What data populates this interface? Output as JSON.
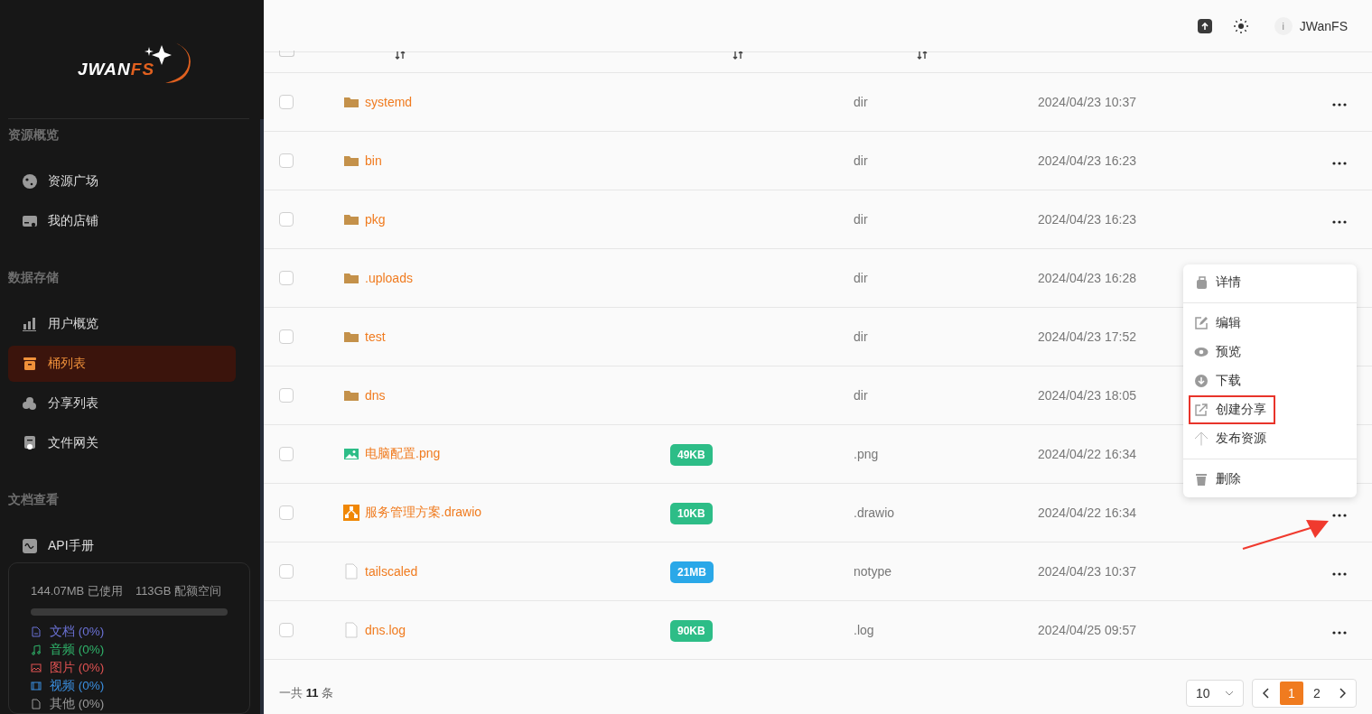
{
  "logo": {
    "main": "JWAN",
    "accent": "FS"
  },
  "sidebar": {
    "sections": [
      {
        "title": "资源概览",
        "items": [
          {
            "label": "资源广场",
            "kind": "globe",
            "selected": false
          },
          {
            "label": "我的店铺",
            "kind": "store",
            "selected": false
          }
        ]
      },
      {
        "title": "数据存储",
        "items": [
          {
            "label": "用户概览",
            "kind": "chart",
            "selected": false
          },
          {
            "label": "桶列表",
            "kind": "bucket",
            "selected": true
          },
          {
            "label": "分享列表",
            "kind": "cloud",
            "selected": false
          },
          {
            "label": "文件网关",
            "kind": "gateway",
            "selected": false
          }
        ]
      },
      {
        "title": "文档查看",
        "items": [
          {
            "label": "API手册",
            "kind": "api",
            "selected": false
          }
        ]
      }
    ],
    "storage": {
      "used": "144.07MB 已使用",
      "quota": "113GB 配额空间",
      "categories": [
        {
          "label": "文档 (0%)",
          "kind": "doc",
          "color": "#6b72d6"
        },
        {
          "label": "音频 (0%)",
          "kind": "audio",
          "color": "#2fb36a"
        },
        {
          "label": "图片 (0%)",
          "kind": "image",
          "color": "#e05252"
        },
        {
          "label": "视频 (0%)",
          "kind": "video",
          "color": "#3b8fe0"
        },
        {
          "label": "其他 (0%)",
          "kind": "other",
          "color": "#9a9a9a"
        }
      ]
    }
  },
  "topbar": {
    "avatar": "i",
    "user": "JWanFS"
  },
  "table": {
    "select_all_checked": false,
    "rows": [
      {
        "name": "systemd",
        "kind": "folder",
        "type": "dir",
        "date": "2024/04/23 10:37",
        "checked": false
      },
      {
        "name": "bin",
        "kind": "folder",
        "type": "dir",
        "date": "2024/04/23 16:23",
        "checked": false
      },
      {
        "name": "pkg",
        "kind": "folder",
        "type": "dir",
        "date": "2024/04/23 16:23",
        "checked": false
      },
      {
        "name": ".uploads",
        "kind": "folder",
        "type": "dir",
        "date": "2024/04/23 16:28",
        "checked": false
      },
      {
        "name": "test",
        "kind": "folder",
        "type": "dir",
        "date": "2024/04/23 17:52",
        "checked": false
      },
      {
        "name": "dns",
        "kind": "folder",
        "type": "dir",
        "date": "2024/04/23 18:05",
        "checked": false
      },
      {
        "name": "电脑配置.png",
        "kind": "image",
        "size": "49KB",
        "color": "#2dbd87",
        "type": ".png",
        "date": "2024/04/22 16:34",
        "checked": false
      },
      {
        "name": "服务管理方案.drawio",
        "kind": "drawio",
        "size": "10KB",
        "color": "#2dbd87",
        "type": ".drawio",
        "date": "2024/04/22 16:34",
        "checked": false
      },
      {
        "name": "tailscaled",
        "kind": "file",
        "size": "21MB",
        "color": "#2aa8e8",
        "type": "notype",
        "date": "2024/04/23 10:37",
        "checked": false
      },
      {
        "name": "dns.log",
        "kind": "file",
        "size": "90KB",
        "color": "#2dbd87",
        "type": ".log",
        "date": "2024/04/25 09:57",
        "checked": false
      }
    ]
  },
  "menu": {
    "groups": [
      [
        {
          "label": "详情",
          "kind": "info",
          "annotated": false
        }
      ],
      [
        {
          "label": "编辑",
          "kind": "edit",
          "annotated": false
        },
        {
          "label": "预览",
          "kind": "eye",
          "annotated": false
        },
        {
          "label": "下载",
          "kind": "download",
          "annotated": false
        },
        {
          "label": "创建分享",
          "kind": "share",
          "annotated": true
        },
        {
          "label": "发布资源",
          "kind": "publish",
          "annotated": false
        }
      ],
      [
        {
          "label": "删除",
          "kind": "delete",
          "annotated": false
        }
      ]
    ]
  },
  "footer": {
    "total_prefix": "一共",
    "total": "11",
    "total_suffix": "条",
    "page_size": "10",
    "pages": [
      {
        "label": "1",
        "selected": true
      },
      {
        "label": "2",
        "selected": false
      }
    ]
  }
}
